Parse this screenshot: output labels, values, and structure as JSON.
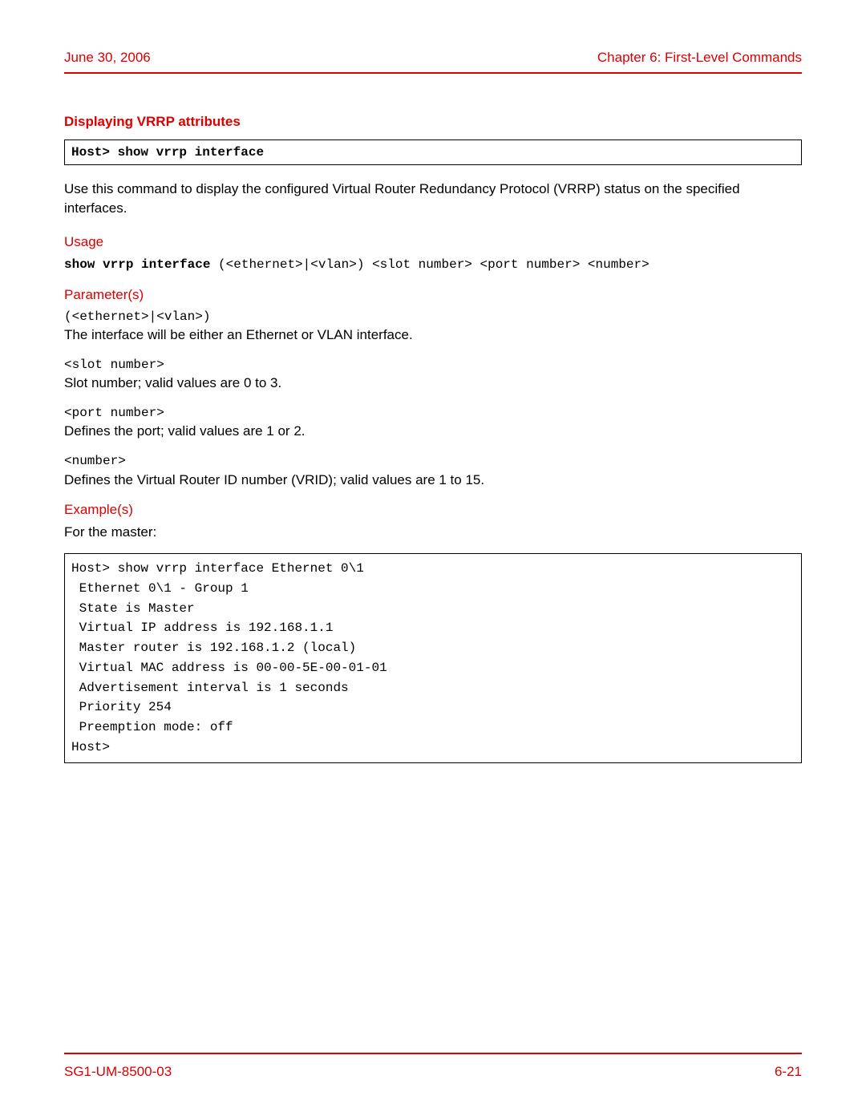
{
  "header": {
    "date": "June 30, 2006",
    "chapter": "Chapter 6: First-Level Commands"
  },
  "section_title": "Displaying VRRP attributes",
  "command_box": "Host> show vrrp interface",
  "intro": "Use this command to display the configured Virtual Router Redundancy Protocol (VRRP) status on the specified interfaces.",
  "usage": {
    "label": "Usage",
    "bold": "show vrrp interface",
    "rest": " (<ethernet>|<vlan>) <slot number> <port number> <number>"
  },
  "parameters": {
    "label": "Parameter(s)",
    "items": [
      {
        "code": "(<ethernet>|<vlan>)",
        "desc": "The interface will be either an Ethernet or VLAN interface."
      },
      {
        "code": "<slot number>",
        "desc": "Slot number; valid values are 0 to 3."
      },
      {
        "code": "<port number>",
        "desc": "Defines the port; valid values are 1 or 2."
      },
      {
        "code": "<number>",
        "desc": "Defines the Virtual Router ID number (VRID); valid values are 1 to 15."
      }
    ]
  },
  "examples": {
    "label": "Example(s)",
    "intro": "For the master:",
    "output": "Host> show vrrp interface Ethernet 0\\1\n Ethernet 0\\1 - Group 1\n State is Master\n Virtual IP address is 192.168.1.1\n Master router is 192.168.1.2 (local)\n Virtual MAC address is 00-00-5E-00-01-01\n Advertisement interval is 1 seconds\n Priority 254\n Preemption mode: off\nHost>"
  },
  "footer": {
    "doc_id": "SG1-UM-8500-03",
    "page_num": "6-21"
  }
}
